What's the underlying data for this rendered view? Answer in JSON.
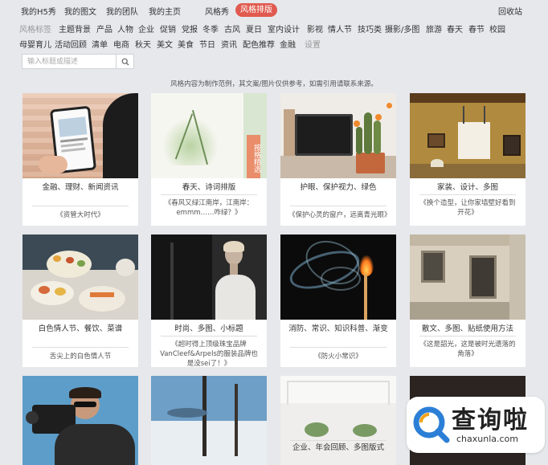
{
  "top_nav": {
    "items": [
      "我的H5秀",
      "我的图文",
      "我的团队",
      "我的主页",
      "风格秀"
    ],
    "active": "风格排版",
    "right": "回收站"
  },
  "tags_row1": [
    "风格标签",
    "主题背景",
    "产品",
    "人物",
    "企业",
    "促销",
    "党报",
    "冬季",
    "古风",
    "夏日",
    "室内设计",
    "影视",
    "情人节",
    "技巧类",
    "摄影/多图",
    "旅游",
    "春天",
    "春节",
    "校园"
  ],
  "tags_row2": [
    "母婴育儿",
    "活动回顾",
    "清单",
    "电商",
    "秋天",
    "美文",
    "美食",
    "节日",
    "资讯",
    "配色推荐",
    "金融",
    "设置"
  ],
  "search": {
    "placeholder": "输入标题或描述"
  },
  "notice": "风格内容为制作范例，其文案/图片仅供参考，如需引用请联系来源。",
  "cards": [
    {
      "tags": "金融、理财、新闻资讯",
      "title": "《资管大时代》"
    },
    {
      "tags": "春天、诗词排版",
      "title": "《春风又绿江南岸，江南岸：emmm……咋绿？》",
      "side_label": "按格精选"
    },
    {
      "tags": "护眼、保护视力、绿色",
      "title": "《保护心灵的窗户，远离青光眼》"
    },
    {
      "tags": "家装、设计、多图",
      "title": "《换个造型，让你家墙壁好看到开花》"
    },
    {
      "tags": "白色情人节、餐饮、菜谱",
      "title": "舌尖上的白色情人节"
    },
    {
      "tags": "时尚、多图、小标题",
      "title": "《超时得上顶级珠宝品牌VanCleef&Arpels的服装品牌也是没sei了！》"
    },
    {
      "tags": "消防、常识、知识科普、渐变",
      "title": "《防火小常识》"
    },
    {
      "tags": "散文、多图、贴纸使用方法",
      "title": "《这是韶光，这是被时光遗落的角落》"
    },
    {
      "tags": "",
      "title": ""
    },
    {
      "tags": "",
      "title": ""
    },
    {
      "tags": "企业、年会回顾、多图版式",
      "title": ""
    },
    {
      "tags": "",
      "title": ""
    }
  ],
  "watermark": {
    "cn": "查询啦",
    "en": "chaxunla.com"
  },
  "colors": {
    "accent": "#e05a4f",
    "background": "#e6e8eb",
    "watermark_blue": "#2c7fd6"
  }
}
